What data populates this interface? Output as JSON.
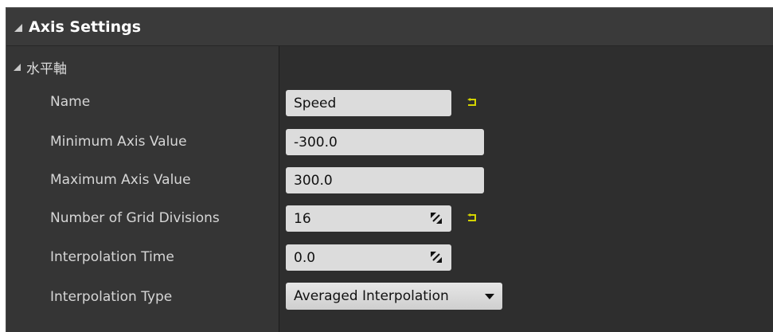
{
  "section": {
    "title": "Axis Settings"
  },
  "category": {
    "label": "水平軸"
  },
  "properties": [
    {
      "label": "Name",
      "value": "Speed"
    },
    {
      "label": "Minimum Axis Value",
      "value": "-300.0"
    },
    {
      "label": "Maximum Axis Value",
      "value": "300.0"
    },
    {
      "label": "Number of Grid Divisions",
      "value": "16"
    },
    {
      "label": "Interpolation Time",
      "value": "0.0"
    },
    {
      "label": "Interpolation Type",
      "value": "Averaged Interpolation"
    }
  ],
  "icons": {
    "section_expand": "triangle-expanded-icon",
    "category_expand": "triangle-expanded-icon",
    "reset": "reset-to-default-icon",
    "spin": "spin-drag-icon",
    "dropdown": "chevron-down-icon"
  },
  "colors": {
    "panel_bg": "#2d2d2d",
    "header_bg": "#3a3a3a",
    "reset_icon": "#d4d400"
  }
}
